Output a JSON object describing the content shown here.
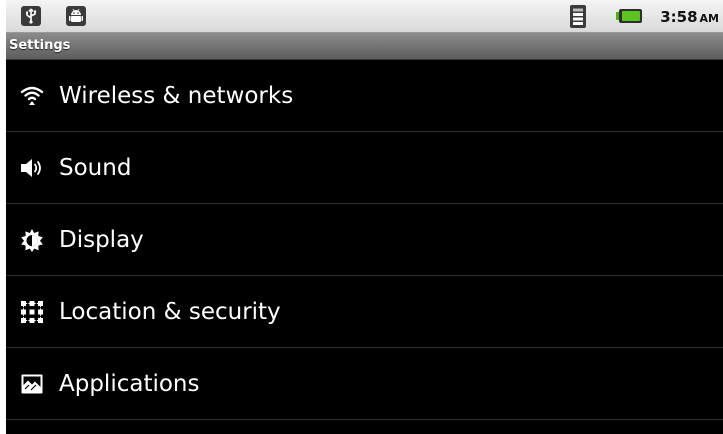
{
  "statusbar": {
    "left_icons": [
      "usb-icon",
      "android-debug-icon"
    ],
    "right_icons": [
      "wifi-signal-icon",
      "battery-icon"
    ],
    "time": "3:58",
    "ampm": "AM"
  },
  "header": {
    "title": "Settings"
  },
  "settings": {
    "items": [
      {
        "label": "Wireless & networks",
        "icon": "wifi-icon"
      },
      {
        "label": "Sound",
        "icon": "speaker-icon"
      },
      {
        "label": "Display",
        "icon": "brightness-icon"
      },
      {
        "label": "Location & security",
        "icon": "location-grid-icon"
      },
      {
        "label": "Applications",
        "icon": "applications-icon"
      }
    ]
  },
  "colors": {
    "background": "#000000",
    "statusbar": "#e6e6e6",
    "titlebar": "#757575",
    "battery": "#4caf1a",
    "text": "#ffffff"
  }
}
